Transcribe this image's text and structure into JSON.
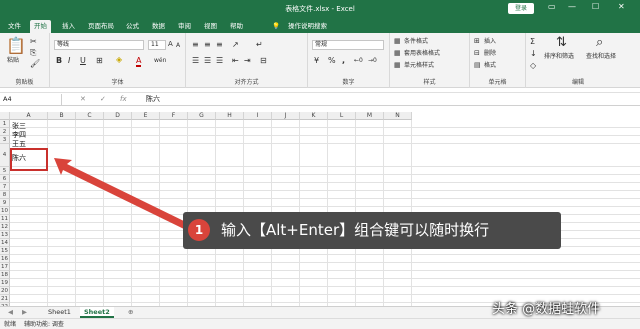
{
  "app": {
    "document_title": "表格文件.xlsx - Excel",
    "login_label": "登录",
    "window_controls": [
      "▭",
      "—",
      "☐",
      "✕"
    ]
  },
  "tabs": [
    "文件",
    "开始",
    "插入",
    "页面布局",
    "公式",
    "数据",
    "审阅",
    "视图",
    "帮助"
  ],
  "tell_me": "操作说明搜索",
  "ribbon": {
    "clipboard": {
      "label": "剪贴板",
      "paste": "粘贴"
    },
    "font": {
      "label": "字体",
      "name": "等线",
      "size": "11",
      "grow": "A",
      "shrink": "A",
      "bold": "B",
      "italic": "I",
      "underline": "U",
      "color_letter": "A",
      "phonetic": "wén"
    },
    "alignment": {
      "label": "对齐方式"
    },
    "number": {
      "label": "数字",
      "format": "常规",
      "percent": "%",
      "comma": ","
    },
    "styles": {
      "label": "样式",
      "items": [
        "条件格式",
        "套用表格格式",
        "单元格样式"
      ]
    },
    "cells": {
      "label": "单元格",
      "items": [
        "插入",
        "删除",
        "格式"
      ]
    },
    "editing": {
      "label": "编辑",
      "sort": "排序和筛选",
      "find": "查找和选择",
      "sigma": "Σ"
    }
  },
  "formula_bar": {
    "cell_ref": "A4",
    "fx": "fx",
    "content": "陈六"
  },
  "columns": [
    "A",
    "B",
    "C",
    "D",
    "E",
    "F",
    "G",
    "H",
    "I",
    "J",
    "K",
    "L",
    "M",
    "N"
  ],
  "rows": [
    "1",
    "2",
    "3",
    "4",
    "5",
    "6",
    "7",
    "8",
    "9",
    "10",
    "11",
    "12",
    "13",
    "14",
    "15",
    "16",
    "17",
    "18",
    "19",
    "20",
    "21",
    "22"
  ],
  "cells": {
    "r1": "张三",
    "r2": "李四",
    "r3": "王五",
    "r4": "陈六"
  },
  "sheets": [
    "Sheet1",
    "Sheet2"
  ],
  "active_sheet": "Sheet2",
  "add_sheet": "⊕",
  "status": {
    "ready": "就绪",
    "accessibility": "辅助功能: 调查"
  },
  "callout": {
    "number": "1",
    "text": "输入【Alt+Enter】组合键可以随时换行"
  },
  "watermark": "头条 @数据蛙软件",
  "colors": {
    "excel_green": "#217346",
    "arrow_red": "#d9443b",
    "highlight_red": "#c9302c"
  }
}
